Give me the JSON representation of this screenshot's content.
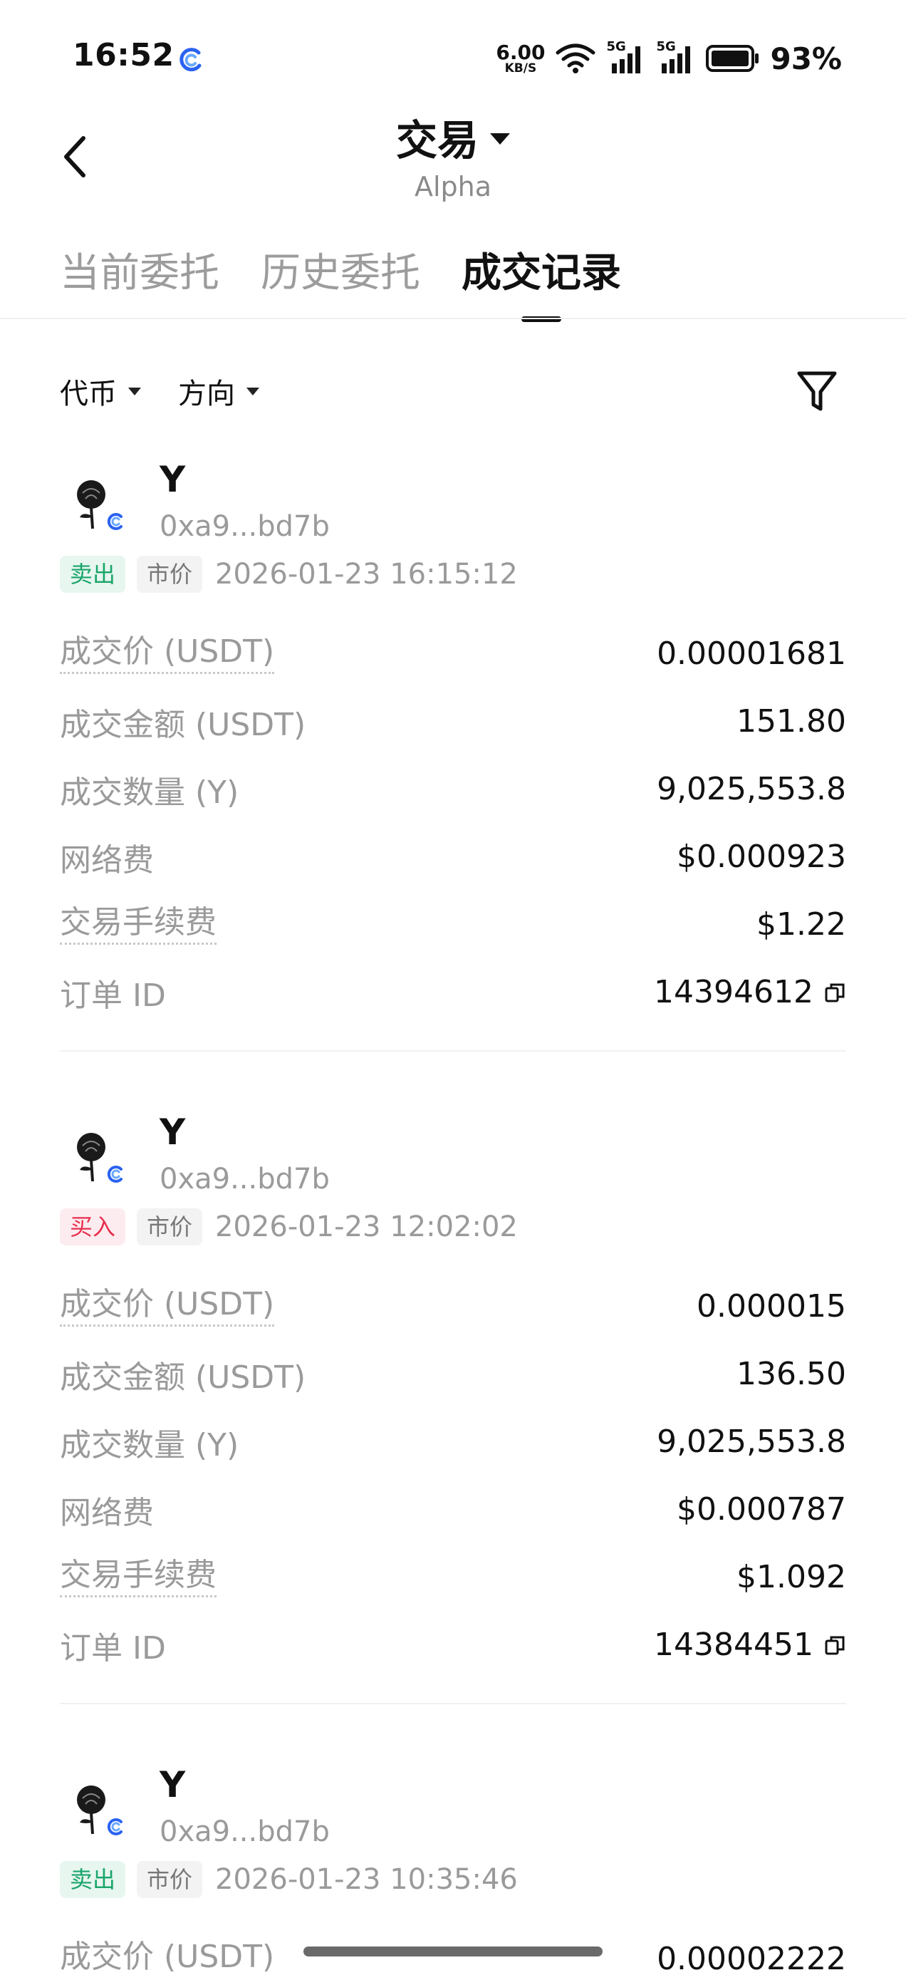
{
  "status_bar": {
    "time": "16:52",
    "net_speed_value": "6.00",
    "net_speed_unit": "KB/S",
    "signal_1_label": "5G",
    "signal_2_label": "5G",
    "battery_pct": "93%"
  },
  "header": {
    "title": "交易",
    "subtitle": "Alpha"
  },
  "tabs": [
    {
      "label": "当前委托",
      "active": false
    },
    {
      "label": "历史委托",
      "active": false
    },
    {
      "label": "成交记录",
      "active": true
    }
  ],
  "filters": {
    "token_label": "代币",
    "direction_label": "方向"
  },
  "trades": [
    {
      "token": "Y",
      "address": "0xa9...bd7b",
      "side": "卖出",
      "order_type": "市价",
      "time": "2026-01-23 16:15:12",
      "fields": [
        {
          "label": "成交价 (USDT)",
          "value": "0.00001681",
          "dotted": true
        },
        {
          "label": "成交金额 (USDT)",
          "value": "151.80",
          "dotted": false
        },
        {
          "label": "成交数量 (Y)",
          "value": "9,025,553.8",
          "dotted": false
        },
        {
          "label": "网络费",
          "value": "$0.000923",
          "dotted": false
        },
        {
          "label": "交易手续费",
          "value": "$1.22",
          "dotted": true
        },
        {
          "label": "订单 ID",
          "value": "14394612",
          "dotted": false,
          "copy": true
        }
      ]
    },
    {
      "token": "Y",
      "address": "0xa9...bd7b",
      "side": "买入",
      "order_type": "市价",
      "time": "2026-01-23 12:02:02",
      "fields": [
        {
          "label": "成交价 (USDT)",
          "value": "0.000015",
          "dotted": true
        },
        {
          "label": "成交金额 (USDT)",
          "value": "136.50",
          "dotted": false
        },
        {
          "label": "成交数量 (Y)",
          "value": "9,025,553.8",
          "dotted": false
        },
        {
          "label": "网络费",
          "value": "$0.000787",
          "dotted": false
        },
        {
          "label": "交易手续费",
          "value": "$1.092",
          "dotted": true
        },
        {
          "label": "订单 ID",
          "value": "14384451",
          "dotted": false,
          "copy": true
        }
      ]
    },
    {
      "token": "Y",
      "address": "0xa9...bd7b",
      "side": "卖出",
      "order_type": "市价",
      "time": "2026-01-23 10:35:46",
      "fields": [
        {
          "label": "成交价 (USDT)",
          "value": "0.00002222",
          "dotted": true
        }
      ]
    }
  ],
  "colors": {
    "sell": "#1aa56b",
    "buy": "#e7304f",
    "app_icon": "#2b63f0"
  },
  "icons": {
    "back": "chevron-left-icon",
    "filter": "funnel-icon",
    "copy": "copy-icon",
    "token_logo": "rose-icon"
  }
}
